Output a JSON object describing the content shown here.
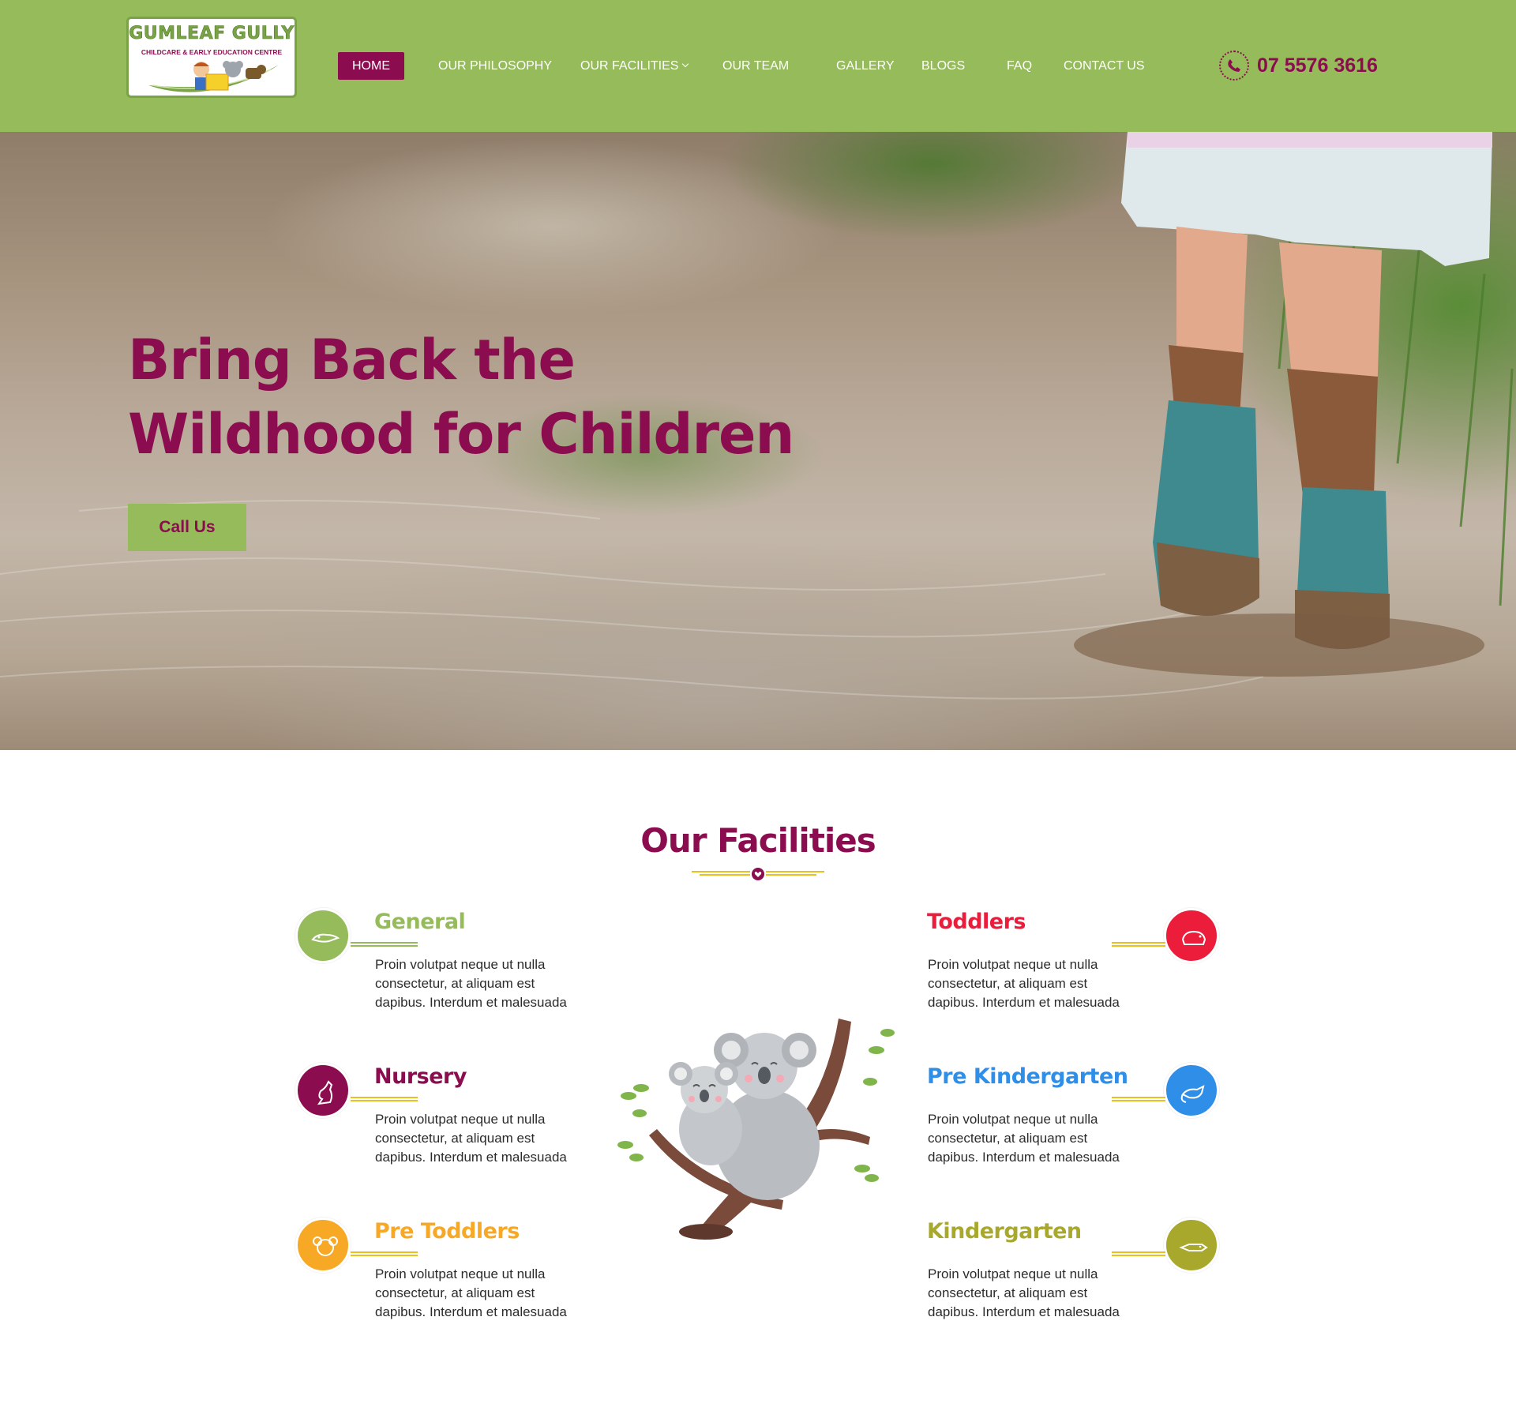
{
  "header": {
    "logo": {
      "title": "GUMLEAF GULLY",
      "subtitle": "CHILDCARE & EARLY EDUCATION CENTRE"
    },
    "nav": [
      {
        "label": "HOME",
        "active": true
      },
      {
        "label": "OUR PHILOSOPHY",
        "active": false
      },
      {
        "label": "OUR FACILITIES",
        "active": false,
        "has_dropdown": true
      },
      {
        "label": "OUR TEAM",
        "active": false
      },
      {
        "label": "GALLERY",
        "active": false
      },
      {
        "label": "BLOGS",
        "active": false
      },
      {
        "label": "FAQ",
        "active": false
      },
      {
        "label": "CONTACT US",
        "active": false
      }
    ],
    "phone": {
      "icon": "phone-icon",
      "number": "07 5576 3616"
    }
  },
  "hero": {
    "title_line1": "Bring Back the",
    "title_line2": "Wildhood for Children",
    "button_label": "Call Us"
  },
  "facilities": {
    "title": "Our Facilities",
    "items": [
      {
        "name": "General",
        "desc": "Proin volutpat neque ut nulla consectetur, at aliquam est dapibus. Interdum et malesuada",
        "color": "#96bb5b",
        "icon": "platypus-icon"
      },
      {
        "name": "Nursery",
        "desc": "Proin volutpat neque ut nulla consectetur, at aliquam est dapibus. Interdum et malesuada",
        "color": "#8b0d4f",
        "icon": "kangaroo-icon"
      },
      {
        "name": "Pre Toddlers",
        "desc": "Proin volutpat neque ut nulla consectetur, at aliquam est dapibus. Interdum et malesuada",
        "color": "#f7a824",
        "icon": "koala-icon"
      },
      {
        "name": "Toddlers",
        "desc": "Proin volutpat neque ut nulla consectetur, at aliquam est dapibus. Interdum et malesuada",
        "color": "#ec1c3b",
        "icon": "wombat-icon"
      },
      {
        "name": "Pre Kindergarten",
        "desc": "Proin volutpat neque ut nulla consectetur, at aliquam est dapibus. Interdum et malesuada",
        "color": "#2f8ee8",
        "icon": "possum-icon"
      },
      {
        "name": "Kindergarten",
        "desc": "Proin volutpat neque ut nulla consectetur, at aliquam est dapibus. Interdum et malesuada",
        "color": "#a8a82c",
        "icon": "crocodile-icon"
      }
    ]
  },
  "colors": {
    "brand_green": "#96bb5b",
    "brand_plum": "#8b0d4f",
    "divider_gold": "#e8c020"
  }
}
